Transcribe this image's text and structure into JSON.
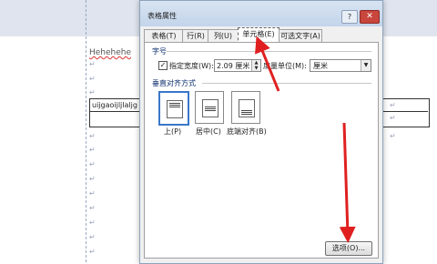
{
  "document": {
    "heading_text": "Hehehehe",
    "table_cell_text": "uijgaoijljlaljg",
    "para_mark": "↵"
  },
  "dialog": {
    "title": "表格属性",
    "help_label": "?",
    "close_label": "✕",
    "tabs": [
      "表格(T)",
      "行(R)",
      "列(U)",
      "单元格(E)",
      "可选文字(A)"
    ],
    "active_tab": "单元格(E)",
    "size_group": {
      "label": "字号",
      "specify_width_label": "指定宽度(W):",
      "specify_width_checked": true,
      "width_value": "2.09 厘米",
      "measure_label": "度量单位(M):",
      "measure_value": "厘米"
    },
    "valign_group": {
      "label": "垂直对齐方式",
      "options": [
        "上(P)",
        "居中(C)",
        "底端对齐(B)"
      ],
      "selected": "上(P)"
    },
    "options_button": "选项(O)..."
  },
  "colors": {
    "arrow": "#e02020",
    "accent": "#3a77c9"
  }
}
